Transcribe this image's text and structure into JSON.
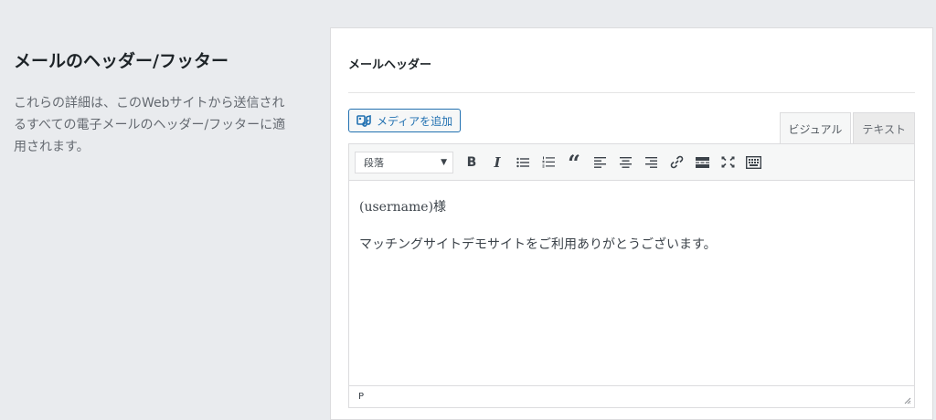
{
  "section": {
    "title": "メールのヘッダー/フッター",
    "description": "これらの詳細は、このWebサイトから送信されるすべての電子メールのヘッダー/フッターに適用されます。"
  },
  "panel": {
    "title": "メールヘッダー"
  },
  "editor": {
    "add_media_label": "メディアを追加",
    "tabs": {
      "visual": "ビジュアル",
      "text": "テキスト"
    },
    "format_select": "段落",
    "toolbar_icons": [
      "bold-icon",
      "italic-icon",
      "bullet-list-icon",
      "numbered-list-icon",
      "blockquote-icon",
      "align-left-icon",
      "align-center-icon",
      "align-right-icon",
      "link-icon",
      "read-more-icon",
      "fullscreen-icon",
      "toolbar-toggle-icon"
    ],
    "bold_glyph": "B",
    "italic_glyph": "I",
    "quote_glyph": "“",
    "content": {
      "line1": "(username)様",
      "line2": "マッチングサイトデモサイトをご利用ありがとうございます。"
    },
    "status_path": "P"
  },
  "colors": {
    "background": "#e9ebee",
    "accent": "#2271b1"
  }
}
